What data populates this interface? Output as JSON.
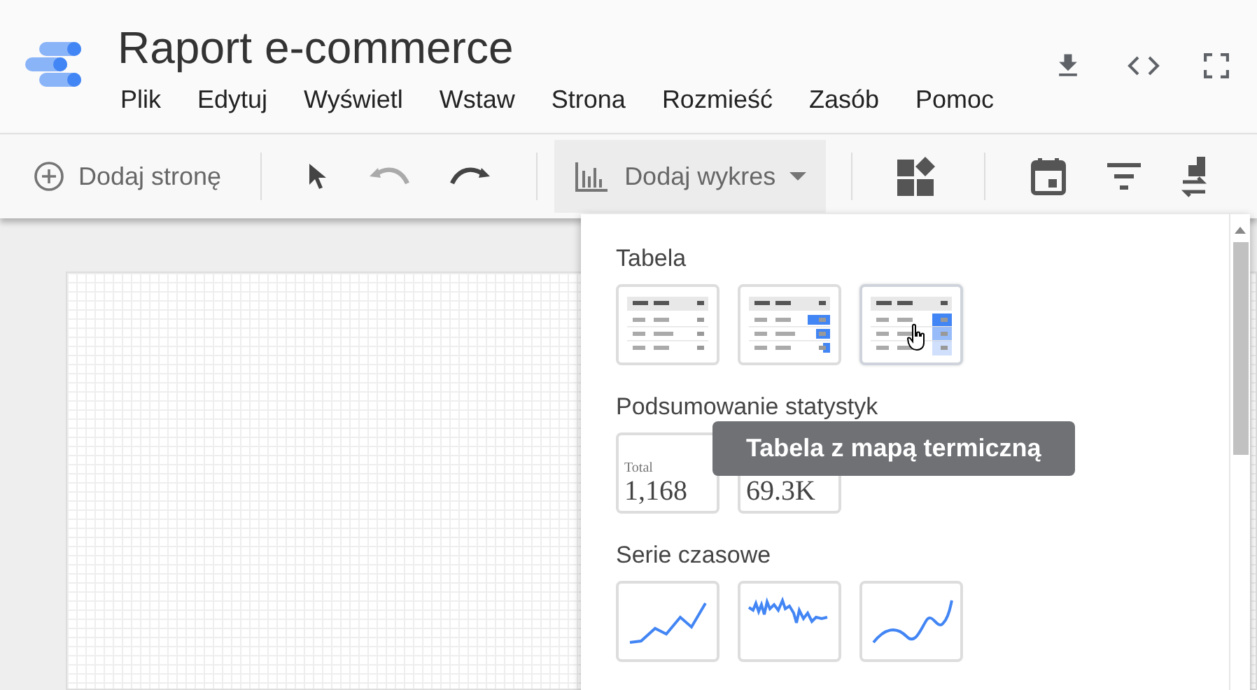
{
  "report": {
    "title": "Raport e-commerce"
  },
  "menu": [
    {
      "label": "Plik"
    },
    {
      "label": "Edytuj"
    },
    {
      "label": "Wyświetl"
    },
    {
      "label": "Wstaw"
    },
    {
      "label": "Strona"
    },
    {
      "label": "Rozmieść"
    },
    {
      "label": "Zasób"
    },
    {
      "label": "Pomoc"
    }
  ],
  "toolbar": {
    "add_page": "Dodaj stronę",
    "add_chart": {
      "label": "Dodaj wykres",
      "expanded": true
    },
    "tools": [
      {
        "kind": "select",
        "disabled": false
      },
      {
        "kind": "undo",
        "disabled": true
      },
      {
        "kind": "redo",
        "disabled": false
      }
    ]
  },
  "chart_menu": {
    "sections": [
      {
        "title": "Tabela",
        "items": [
          {
            "kind": "table",
            "hovered": false
          },
          {
            "kind": "table-bars",
            "hovered": false
          },
          {
            "kind": "table-heatmap",
            "hovered": true
          }
        ]
      },
      {
        "title": "Podsumowanie statystyk",
        "items": [
          {
            "kind": "scorecard",
            "hovered": false,
            "label": "Total",
            "value": "1,168"
          },
          {
            "kind": "scorecard",
            "hovered": false,
            "value": "69.3K"
          }
        ]
      },
      {
        "title": "Serie czasowe",
        "items": [
          {
            "kind": "line",
            "hovered": false
          },
          {
            "kind": "line-noisy",
            "hovered": false
          },
          {
            "kind": "line-smooth",
            "hovered": false
          }
        ]
      }
    ],
    "tooltip": "Tabela z mapą termiczną"
  }
}
